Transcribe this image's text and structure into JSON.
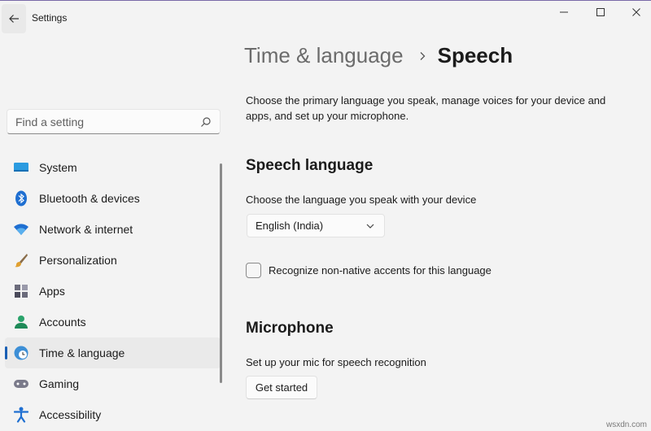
{
  "app": {
    "title": "Settings"
  },
  "search": {
    "placeholder": "Find a setting"
  },
  "sidebar": {
    "items": [
      {
        "label": "System",
        "icon": "system-icon"
      },
      {
        "label": "Bluetooth & devices",
        "icon": "bluetooth-icon"
      },
      {
        "label": "Network & internet",
        "icon": "wifi-icon"
      },
      {
        "label": "Personalization",
        "icon": "brush-icon"
      },
      {
        "label": "Apps",
        "icon": "apps-icon"
      },
      {
        "label": "Accounts",
        "icon": "person-icon"
      },
      {
        "label": "Time & language",
        "icon": "globe-clock-icon",
        "active": true
      },
      {
        "label": "Gaming",
        "icon": "gamepad-icon"
      },
      {
        "label": "Accessibility",
        "icon": "accessibility-icon"
      }
    ]
  },
  "header": {
    "parent": "Time & language",
    "current": "Speech"
  },
  "intro": "Choose the primary language you speak, manage voices for your device and apps, and set up your microphone.",
  "speech_language": {
    "title": "Speech language",
    "description": "Choose the language you speak with your device",
    "selected": "English (India)",
    "accent_checkbox_label": "Recognize non-native accents for this language",
    "accent_checked": false
  },
  "microphone": {
    "title": "Microphone",
    "description": "Set up your mic for speech recognition",
    "button_label": "Get started"
  },
  "watermark": "wsxdn.com",
  "colors": {
    "accent": "#1a5fb4",
    "background": "#f3f3f3"
  }
}
